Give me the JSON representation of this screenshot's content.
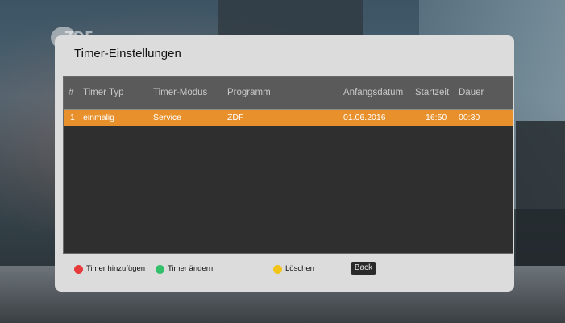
{
  "channel_logo": "ZDF",
  "panel": {
    "title": "Timer-Einstellungen"
  },
  "table": {
    "columns": [
      "#",
      "Timer Typ",
      "Timer-Modus",
      "Programm",
      "Anfangsdatum",
      "Startzeit",
      "Dauer"
    ],
    "rows": [
      [
        "1",
        "einmalig",
        "Service",
        "ZDF",
        "01.06.2016",
        "16:50",
        "00:30"
      ]
    ]
  },
  "footer": {
    "red_label": "Timer hinzufügen",
    "green_label": "Timer ändern",
    "yellow_label": "Löschen",
    "back_label": "Back"
  },
  "colors": {
    "red": "#e83a3a",
    "green": "#33c06a",
    "yellow": "#f2c418",
    "selection": "#e8912c"
  }
}
